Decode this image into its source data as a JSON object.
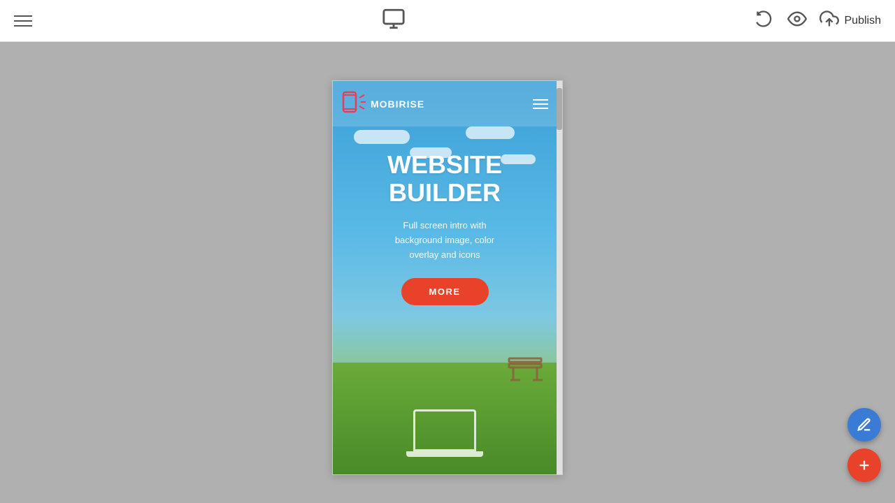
{
  "toolbar": {
    "publish_label": "Publish",
    "menu_icon_name": "hamburger-menu-icon",
    "monitor_icon_name": "monitor-icon",
    "undo_icon_name": "undo-icon",
    "eye_icon_name": "preview-eye-icon",
    "cloud_upload_icon_name": "cloud-upload-icon"
  },
  "preview": {
    "nav": {
      "logo_text": "MOBIRISE",
      "logo_icon_name": "mobirise-logo-icon",
      "menu_icon_name": "preview-hamburger-icon"
    },
    "hero": {
      "headline_line1": "WEBSITE",
      "headline_line2": "BUILDER",
      "subtext": "Full screen intro with\nbackground image, color\noverlay and icons",
      "more_button_label": "MORE"
    }
  },
  "fab": {
    "edit_icon_name": "edit-pencil-icon",
    "add_icon_name": "add-plus-icon"
  }
}
